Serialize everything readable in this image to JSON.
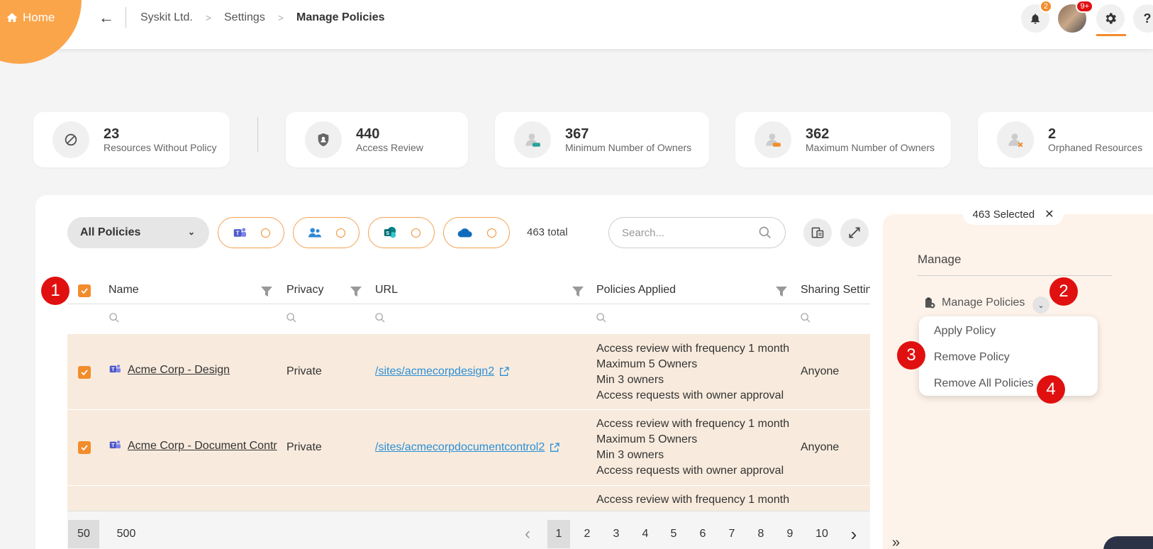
{
  "header": {
    "home_label": "Home",
    "breadcrumbs": [
      "Syskit Ltd.",
      "Settings",
      "Manage Policies"
    ],
    "notifications_count": "2",
    "avatar_badge": "9+",
    "accent": "#f28c2c"
  },
  "stats": [
    {
      "value": "23",
      "label": "Resources Without Policy",
      "icon": "car-ban-icon"
    },
    {
      "value": "440",
      "label": "Access Review",
      "icon": "shield-user-icon"
    },
    {
      "value": "367",
      "label": "Minimum Number of Owners",
      "icon": "user-min-icon"
    },
    {
      "value": "362",
      "label": "Maximum Number of Owners",
      "icon": "user-max-icon"
    },
    {
      "value": "2",
      "label": "Orphaned Resources",
      "icon": "user-orphan-icon"
    }
  ],
  "toolbar": {
    "policy_filter": "All Policies",
    "total": "463 total",
    "search_placeholder": "Search..."
  },
  "table": {
    "columns": [
      "Name",
      "Privacy",
      "URL",
      "Policies Applied",
      "Sharing Settin"
    ],
    "rows": [
      {
        "name": "Acme Corp - Design",
        "privacy": "Private",
        "url": "/sites/acmecorpdesign2",
        "policies": [
          "Access review with frequency 1 month",
          "Maximum 5 Owners",
          "Min 3 owners",
          "Access requests with owner approval"
        ],
        "sharing": "Anyone"
      },
      {
        "name": "Acme Corp - Document Contr",
        "privacy": "Private",
        "url": "/sites/acmecorpdocumentcontrol2",
        "policies": [
          "Access review with frequency 1 month",
          "Maximum 5 Owners",
          "Min 3 owners",
          "Access requests with owner approval"
        ],
        "sharing": "Anyone"
      },
      {
        "policies": [
          "Access review with frequency 1 month"
        ]
      }
    ]
  },
  "pagination": {
    "page_sizes": [
      "50",
      "500"
    ],
    "pages": [
      "1",
      "2",
      "3",
      "4",
      "5",
      "6",
      "7",
      "8",
      "9",
      "10"
    ]
  },
  "side_panel": {
    "selected_label": "463 Selected",
    "manage_title": "Manage",
    "manage_policies_label": "Manage Policies",
    "menu": [
      "Apply Policy",
      "Remove Policy",
      "Remove All Policies"
    ]
  },
  "steps": [
    "1",
    "2",
    "3",
    "4"
  ]
}
